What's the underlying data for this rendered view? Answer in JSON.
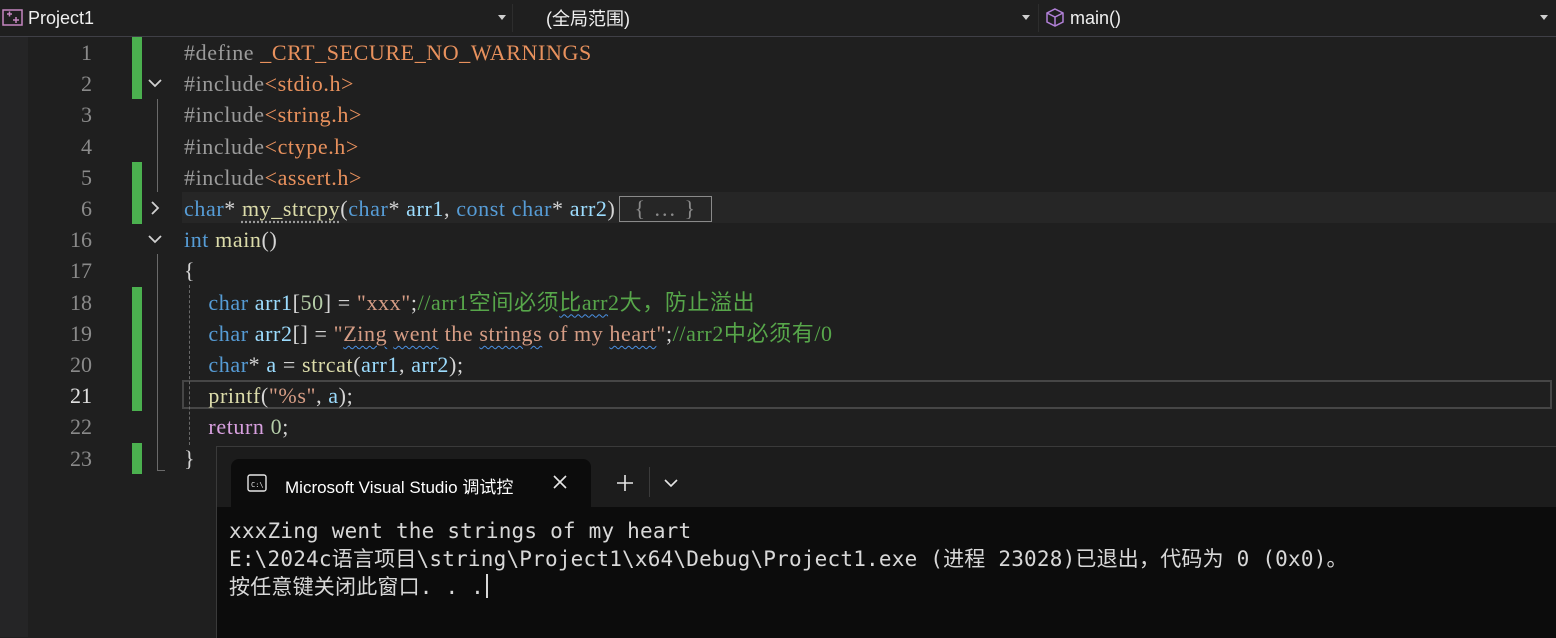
{
  "navbar": {
    "project": "Project1",
    "scope": "(全局范围)",
    "member": "main()"
  },
  "editor": {
    "lines": [
      {
        "n": "1",
        "c": [
          [
            "pp",
            "#define "
          ],
          [
            "id2",
            "_CRT_SECURE_NO_WARNINGS"
          ]
        ]
      },
      {
        "n": "2",
        "c": [
          [
            "pp",
            "#include"
          ],
          [
            "inc",
            "<stdio.h>"
          ]
        ]
      },
      {
        "n": "3",
        "c": [
          [
            "pp",
            "#include"
          ],
          [
            "inc",
            "<string.h>"
          ]
        ]
      },
      {
        "n": "4",
        "c": [
          [
            "pp",
            "#include"
          ],
          [
            "inc",
            "<ctype.h>"
          ]
        ]
      },
      {
        "n": "5",
        "c": [
          [
            "pp",
            "#include"
          ],
          [
            "inc",
            "<assert.h>"
          ]
        ]
      },
      {
        "n": "6",
        "c": [
          [
            "kw",
            "char"
          ],
          [
            "punct",
            "* "
          ],
          [
            "fnd",
            "my_strcpy"
          ],
          [
            "punct",
            "("
          ],
          [
            "kw",
            "char"
          ],
          [
            "punct",
            "* "
          ],
          [
            "param",
            "arr1"
          ],
          [
            "punct",
            ", "
          ],
          [
            "kw",
            "const "
          ],
          [
            "kw",
            "char"
          ],
          [
            "punct",
            "* "
          ],
          [
            "param",
            "arr2"
          ],
          [
            "punct",
            ")"
          ],
          [
            "box",
            "{ ... }"
          ]
        ]
      },
      {
        "n": "16",
        "c": [
          [
            "kw",
            "int "
          ],
          [
            "fn",
            "main"
          ],
          [
            "punct",
            "()"
          ]
        ]
      },
      {
        "n": "17",
        "c": [
          [
            "punct",
            "{"
          ]
        ]
      },
      {
        "n": "18",
        "c": [
          [
            "sp",
            "    "
          ],
          [
            "kw",
            "char "
          ],
          [
            "id",
            "arr1"
          ],
          [
            "punct",
            "["
          ],
          [
            "num",
            "50"
          ],
          [
            "punct",
            "] = "
          ],
          [
            "str",
            "\"xxx\""
          ],
          [
            "punct",
            ";"
          ],
          [
            "com",
            "//arr1空间必须"
          ],
          [
            "comsq",
            "比arr"
          ],
          [
            "com",
            "2大，防止溢出"
          ]
        ]
      },
      {
        "n": "19",
        "c": [
          [
            "sp",
            "    "
          ],
          [
            "kw",
            "char "
          ],
          [
            "id",
            "arr2"
          ],
          [
            "punct",
            "[] = "
          ],
          [
            "str",
            "\""
          ],
          [
            "strsq",
            "Zing"
          ],
          [
            "str",
            " "
          ],
          [
            "strsq",
            "went"
          ],
          [
            "str",
            " the "
          ],
          [
            "strsq",
            "strings"
          ],
          [
            "str",
            " of my "
          ],
          [
            "strsq",
            "heart"
          ],
          [
            "str",
            "\""
          ],
          [
            "punct",
            ";"
          ],
          [
            "com",
            "//arr2中必须有/0"
          ]
        ]
      },
      {
        "n": "20",
        "c": [
          [
            "sp",
            "    "
          ],
          [
            "kw",
            "char"
          ],
          [
            "punct",
            "* "
          ],
          [
            "id",
            "a"
          ],
          [
            "punct",
            " = "
          ],
          [
            "fn",
            "strcat"
          ],
          [
            "punct",
            "("
          ],
          [
            "id",
            "arr1"
          ],
          [
            "punct",
            ", "
          ],
          [
            "id",
            "arr2"
          ],
          [
            "punct",
            ");"
          ]
        ]
      },
      {
        "n": "21",
        "c": [
          [
            "sp",
            "    "
          ],
          [
            "fn",
            "printf"
          ],
          [
            "punct",
            "("
          ],
          [
            "str",
            "\"%s\""
          ],
          [
            "punct",
            ", "
          ],
          [
            "id",
            "a"
          ],
          [
            "punct",
            ");"
          ]
        ]
      },
      {
        "n": "22",
        "c": [
          [
            "sp",
            "    "
          ],
          [
            "ctl",
            "return "
          ],
          [
            "num",
            "0"
          ],
          [
            "punct",
            ";"
          ]
        ]
      },
      {
        "n": "23",
        "c": [
          [
            "punct",
            "}"
          ]
        ]
      }
    ]
  },
  "terminal": {
    "tab_title": "Microsoft Visual Studio 调试控",
    "output": [
      "xxxZing went the strings of my heart",
      "E:\\2024c语言项目\\string\\Project1\\x64\\Debug\\Project1.exe (进程 23028)已退出，代码为 0 (0x0)。",
      "按任意键关闭此窗口. . ."
    ]
  }
}
